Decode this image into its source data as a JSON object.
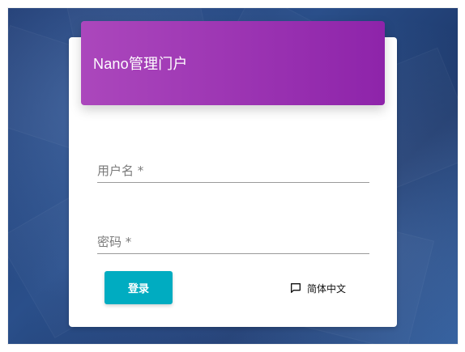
{
  "header": {
    "title": "Nano管理门户"
  },
  "login_form": {
    "username_label": "用户名 *",
    "password_label": "密码 *",
    "login_button_label": "登录"
  },
  "language": {
    "current_label": "简体中文",
    "icon": "chat-bubble-icon"
  },
  "colors": {
    "header_gradient_start": "#ab47bc",
    "header_gradient_end": "#8e24aa",
    "login_button": "#00acc1",
    "background_blue": "#1f3a70"
  }
}
